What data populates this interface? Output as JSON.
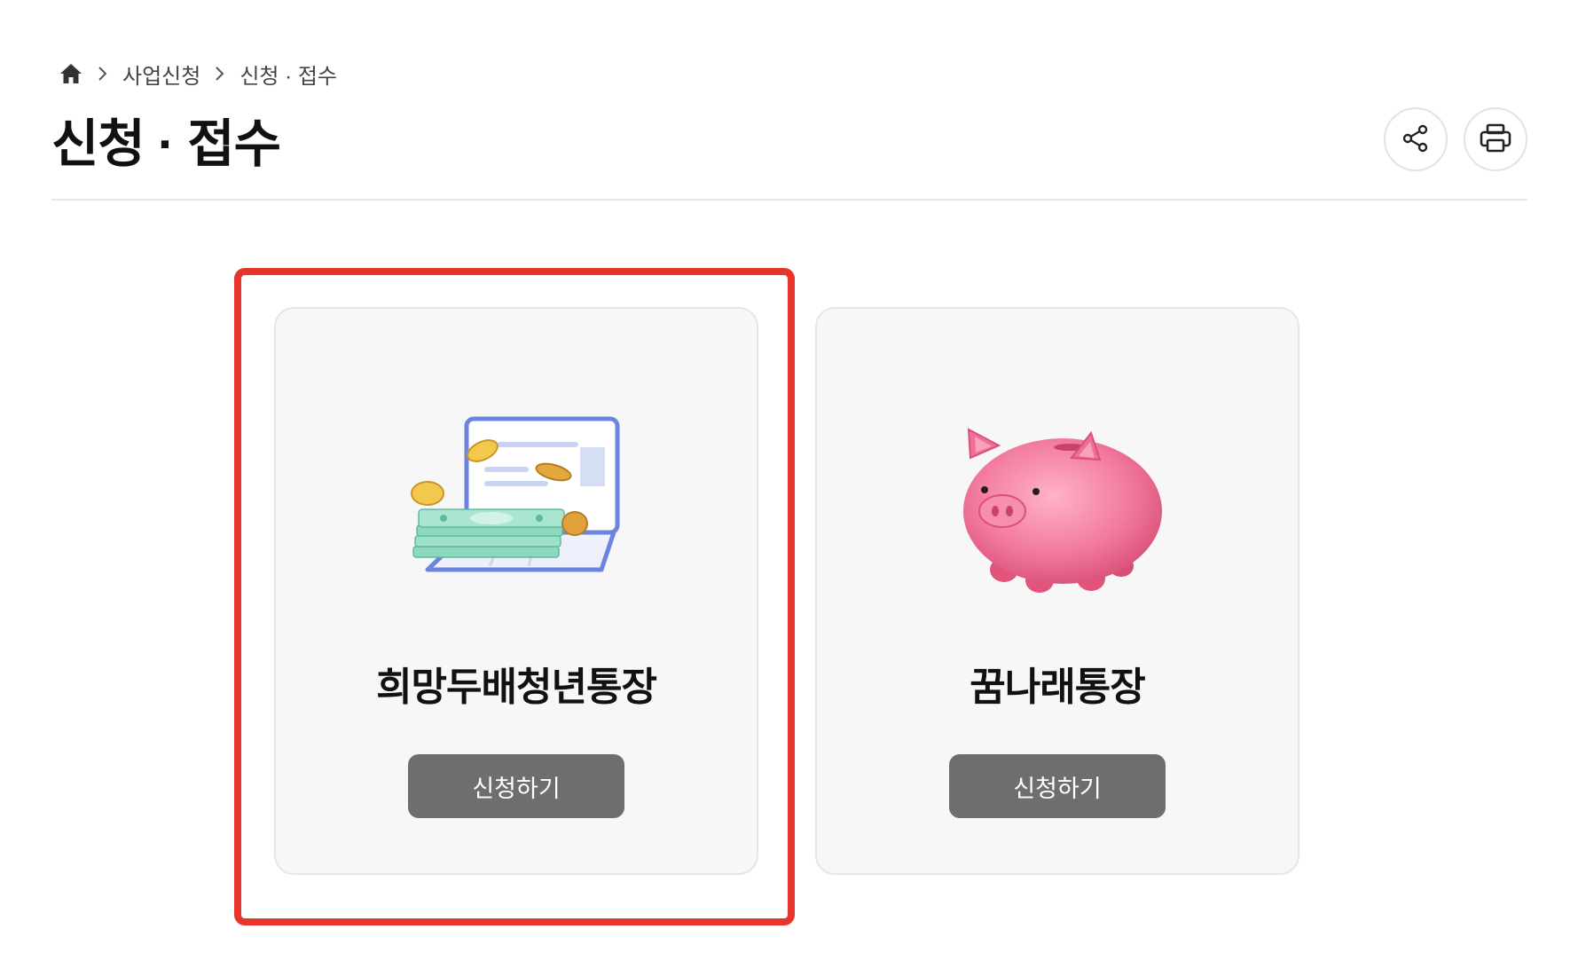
{
  "breadcrumb": {
    "home_icon": "home-icon",
    "separator_icon": "chevron-right-icon",
    "items": [
      {
        "label": "사업신청"
      },
      {
        "label": "신청 · 접수"
      }
    ]
  },
  "header": {
    "title": "신청 · 접수",
    "actions": {
      "share_icon": "share-icon",
      "print_icon": "print-icon"
    }
  },
  "cards": [
    {
      "title": "희망두배청년통장",
      "button_label": "신청하기",
      "illustration": "laptop-money-coins",
      "highlighted": true
    },
    {
      "title": "꿈나래통장",
      "button_label": "신청하기",
      "illustration": "piggy-bank",
      "highlighted": false
    }
  ],
  "colors": {
    "highlight_border": "#e7352b",
    "button_bg": "#6e6e6e",
    "card_bg": "#f7f7f7"
  }
}
